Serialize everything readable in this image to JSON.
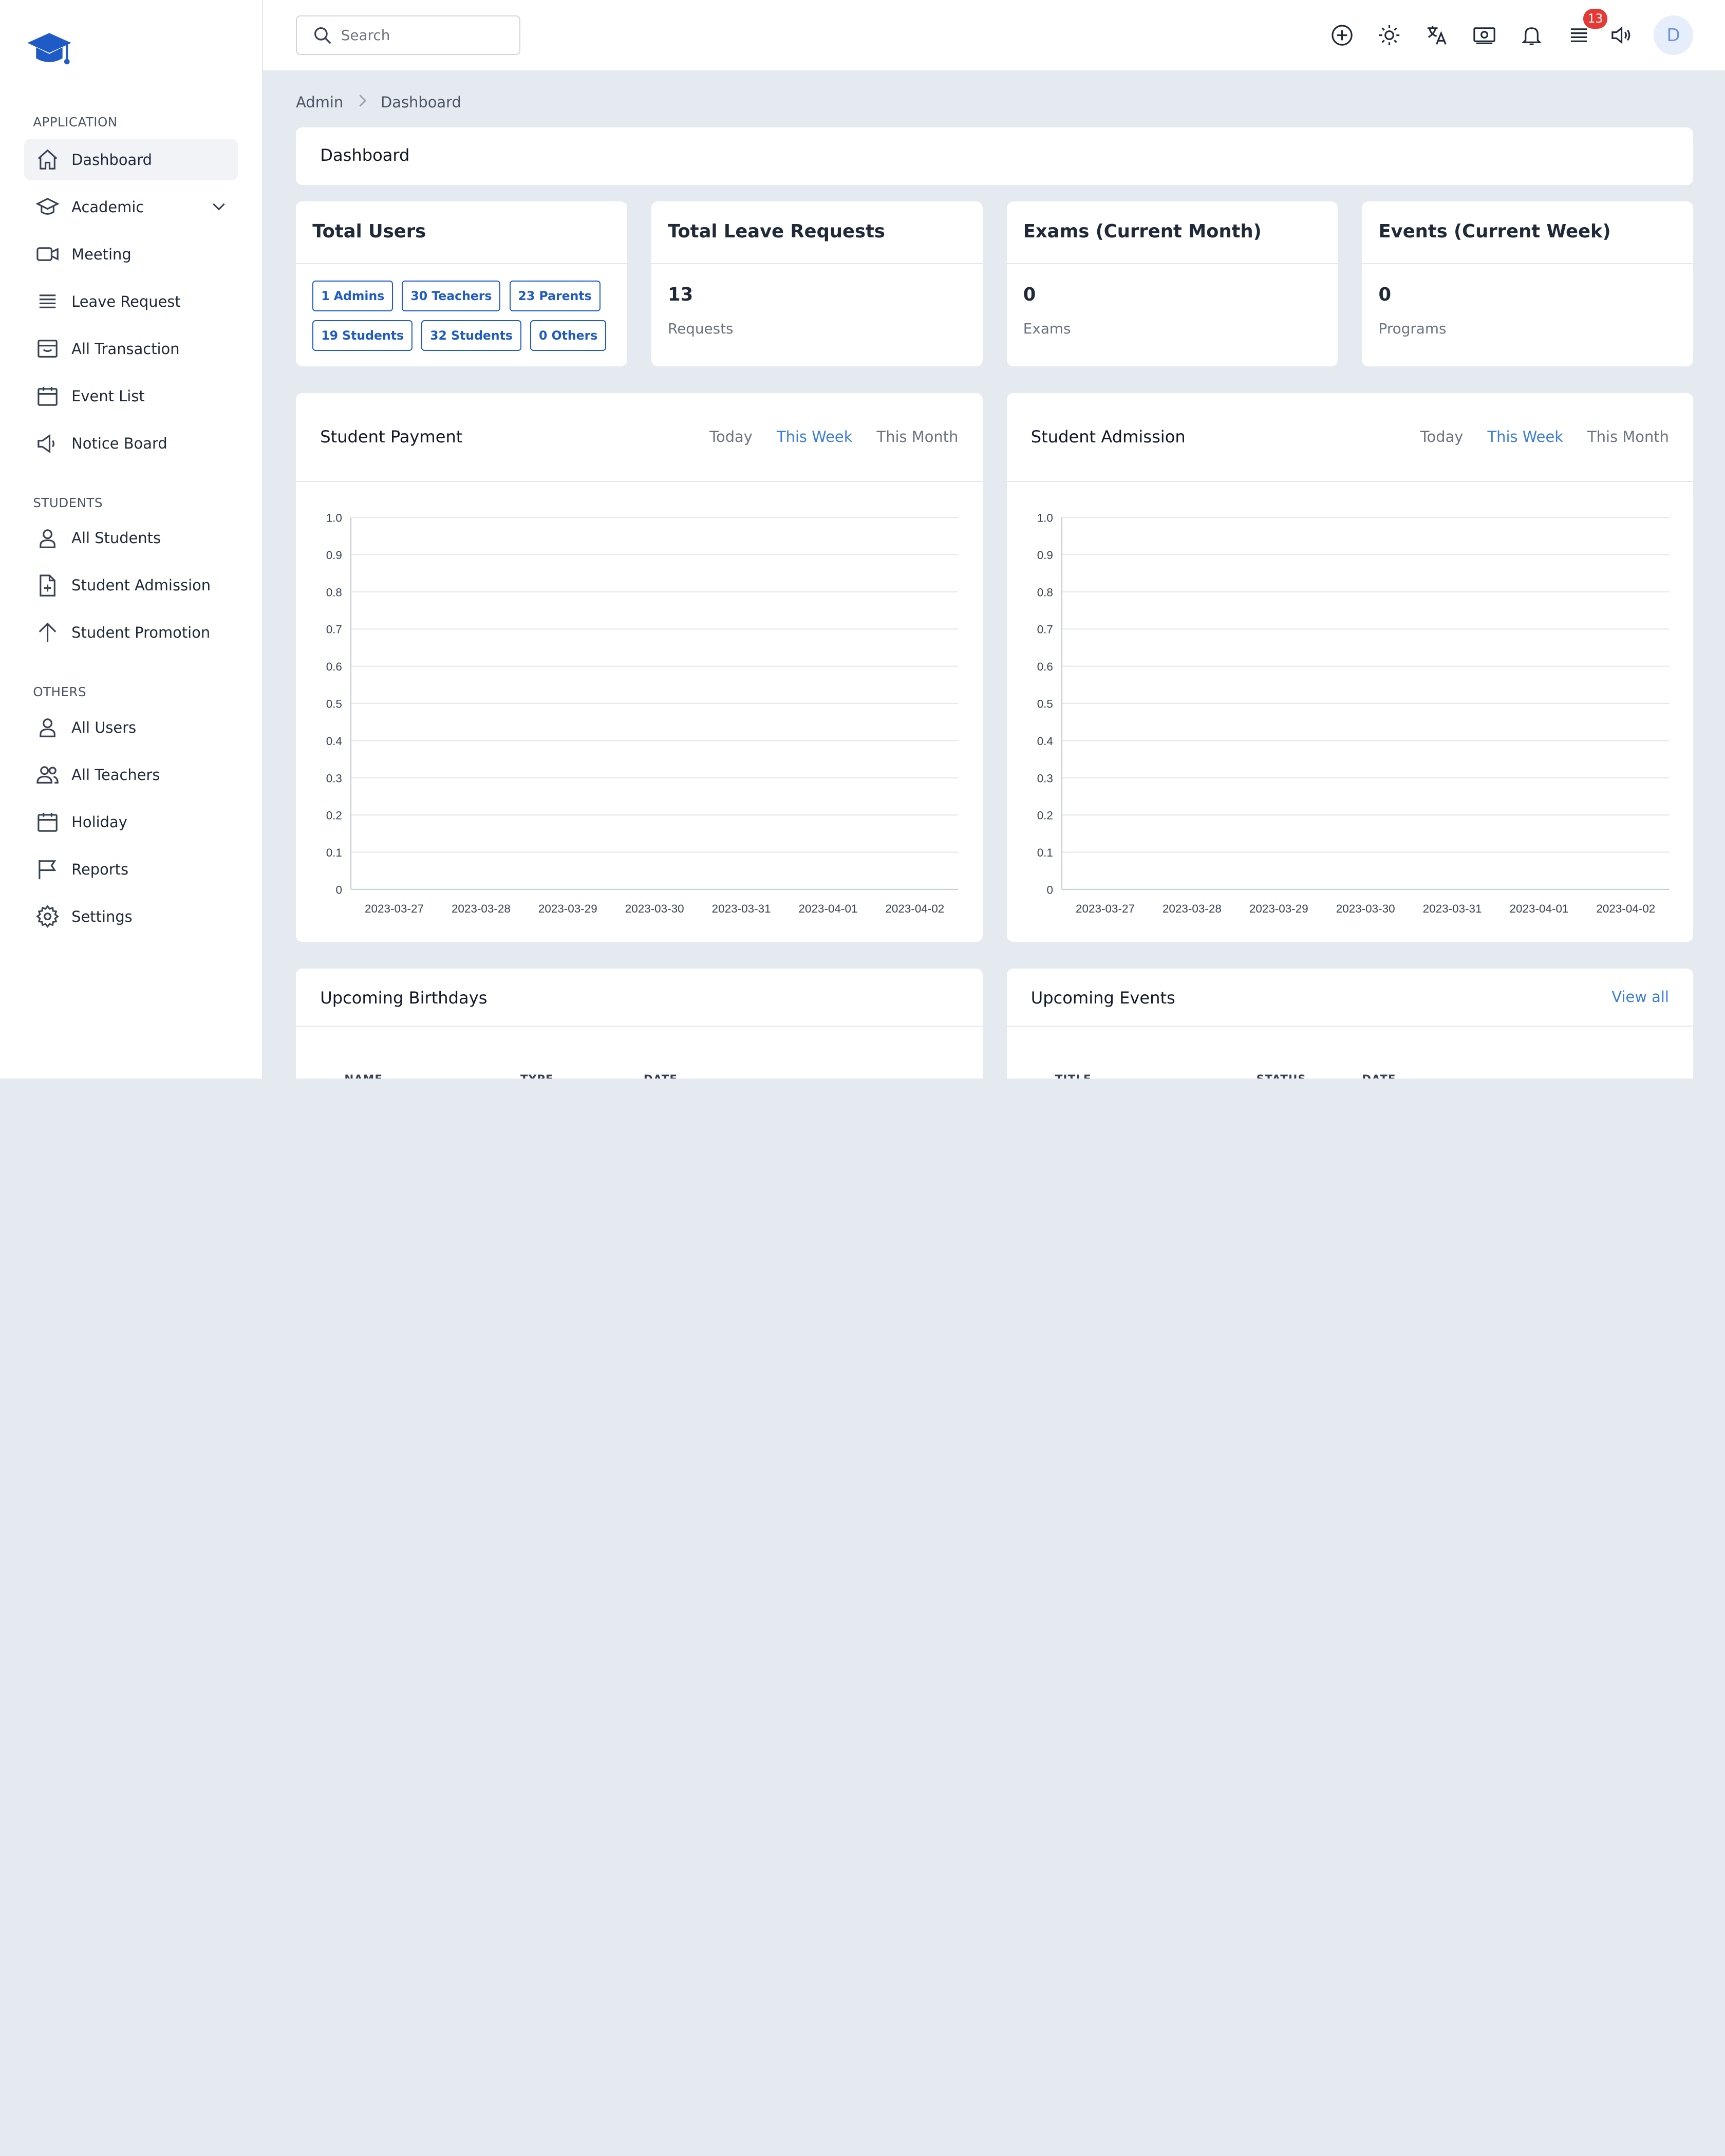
{
  "sidebar": {
    "sections": [
      {
        "title": "APPLICATION"
      },
      {
        "title": "STUDENTS"
      },
      {
        "title": "OTHERS"
      }
    ],
    "items": [
      {
        "label": "Dashboard",
        "icon": "home-icon",
        "active": true
      },
      {
        "label": "Academic",
        "icon": "graduation-cap-icon"
      },
      {
        "label": "Meeting",
        "icon": "video-icon"
      },
      {
        "label": "Leave Request",
        "icon": "list-icon"
      },
      {
        "label": "All Transaction",
        "icon": "archive-icon"
      },
      {
        "label": "Event List",
        "icon": "calendar-icon"
      },
      {
        "label": "Notice Board",
        "icon": "megaphone-icon"
      },
      {
        "label": "All Students",
        "icon": "user-icon"
      },
      {
        "label": "Student Admission",
        "icon": "file-plus-icon"
      },
      {
        "label": "Student Promotion",
        "icon": "arrow-up-icon"
      },
      {
        "label": "All Users",
        "icon": "user-icon"
      },
      {
        "label": "All Teachers",
        "icon": "users-icon"
      },
      {
        "label": "Holiday",
        "icon": "calendar-icon"
      },
      {
        "label": "Reports",
        "icon": "flag-icon"
      },
      {
        "label": "Settings",
        "icon": "gear-icon"
      }
    ]
  },
  "header": {
    "search_placeholder": "Search",
    "notification_count": "13",
    "avatar_initial": "D"
  },
  "breadcrumb": {
    "root": "Admin",
    "current": "Dashboard"
  },
  "page": {
    "title": "Dashboard"
  },
  "stats": {
    "total_users": {
      "title": "Total Users",
      "chips": [
        "1 Admins",
        "30 Teachers",
        "23 Parents",
        "19 Students",
        "32 Students",
        "0 Others"
      ]
    },
    "leave": {
      "title": "Total Leave Requests",
      "value": "13",
      "caption": "Requests"
    },
    "exams": {
      "title": "Exams (Current Month)",
      "value": "0",
      "caption": "Exams"
    },
    "events": {
      "title": "Events (Current Week)",
      "value": "0",
      "caption": "Programs"
    }
  },
  "charts": {
    "payment": {
      "title": "Student Payment",
      "tabs": [
        "Today",
        "This Week",
        "This Month"
      ],
      "active_tab": "This Week"
    },
    "admission": {
      "title": "Student Admission",
      "tabs": [
        "Today",
        "This Week",
        "This Month"
      ],
      "active_tab": "This Week"
    }
  },
  "chart_data": [
    {
      "type": "line",
      "x": [
        "2023-03-27",
        "2023-03-28",
        "2023-03-29",
        "2023-03-30",
        "2023-03-31",
        "2023-04-01",
        "2023-04-02"
      ],
      "series": [
        {
          "values": [
            0,
            0,
            0,
            0,
            0,
            0,
            0
          ]
        }
      ],
      "ylim": [
        0,
        1.0
      ],
      "yticks": [
        "0",
        "0.1",
        "0.2",
        "0.3",
        "0.4",
        "0.5",
        "0.6",
        "0.7",
        "0.8",
        "0.9",
        "1.0"
      ],
      "grid": true
    },
    {
      "type": "line",
      "x": [
        "2023-03-27",
        "2023-03-28",
        "2023-03-29",
        "2023-03-30",
        "2023-03-31",
        "2023-04-01",
        "2023-04-02"
      ],
      "series": [
        {
          "values": [
            0,
            0,
            0,
            0,
            0,
            0,
            0
          ]
        }
      ],
      "ylim": [
        0,
        1.0
      ],
      "yticks": [
        "0",
        "0.1",
        "0.2",
        "0.3",
        "0.4",
        "0.5",
        "0.6",
        "0.7",
        "0.8",
        "0.9",
        "1.0"
      ],
      "grid": true
    }
  ],
  "birthdays": {
    "title": "Upcoming Birthdays",
    "columns": [
      "NAME",
      "TYPE",
      "DATE"
    ]
  },
  "events_list": {
    "title": "Upcoming Events",
    "view_all": "View all",
    "columns": [
      "TITLE",
      "STATUS",
      "DATE"
    ]
  },
  "colors": {
    "accent": "#3b7ddd",
    "chip": "#1e5bc6",
    "badge": "#e53935",
    "logo": "#1e5bc6"
  }
}
